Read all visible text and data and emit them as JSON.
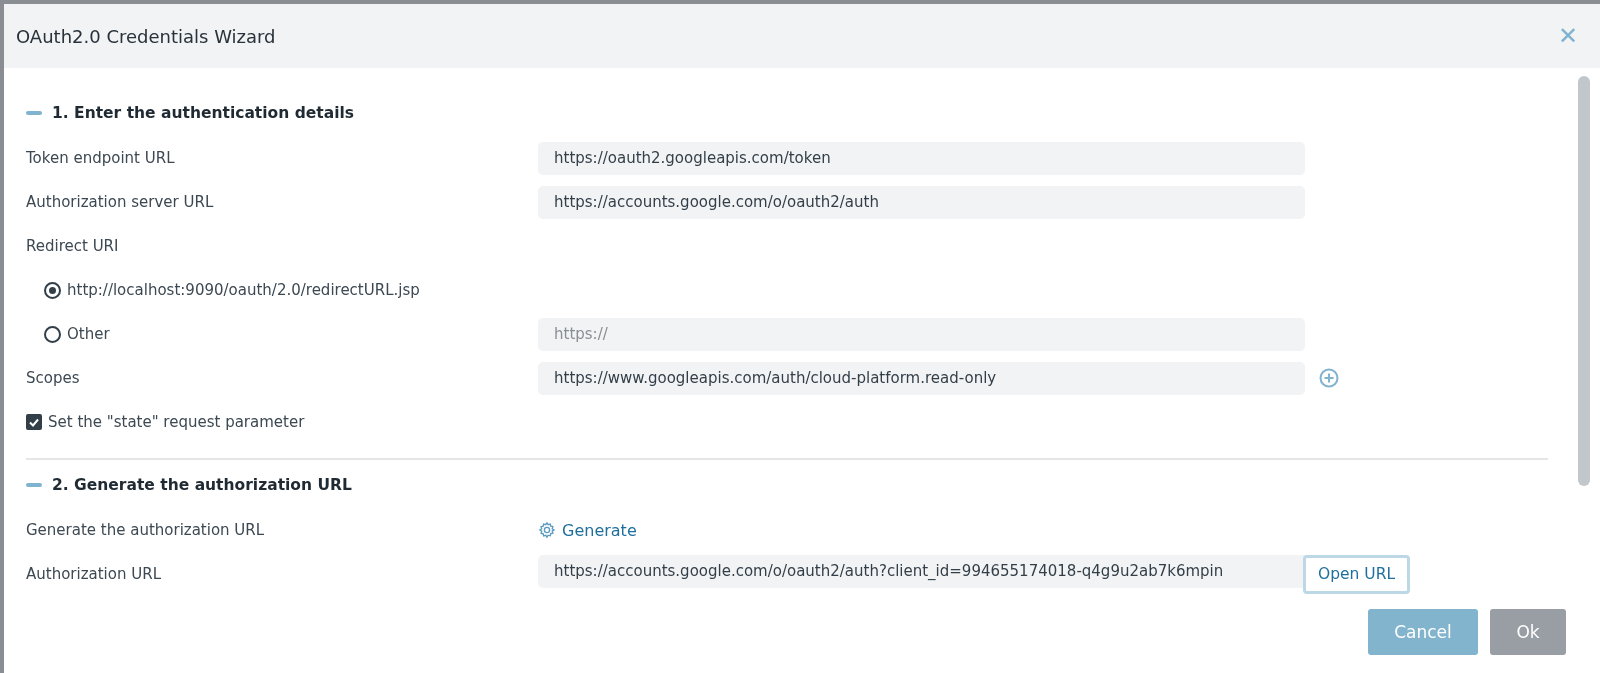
{
  "window": {
    "title": "OAuth2.0 Credentials Wizard",
    "close": "✕"
  },
  "sections": [
    {
      "title": "1. Enter the authentication details",
      "expanded": true,
      "rows": [
        {
          "kind": "field",
          "label": "Token endpoint URL",
          "value": "https://oauth2.googleapis.com/token"
        },
        {
          "kind": "field",
          "label": "Authorization server URL",
          "value": "https://accounts.google.com/o/oauth2/auth"
        },
        {
          "kind": "label",
          "label": "Redirect URI"
        },
        {
          "kind": "radio",
          "label": "http://localhost:9090/oauth/2.0/redirectURL.jsp",
          "selected": true
        },
        {
          "kind": "radio",
          "label": "Other",
          "selected": false,
          "placeholder": "https://"
        },
        {
          "kind": "field",
          "label": "Scopes",
          "value": "https://www.googleapis.com/auth/cloud-platform.read-only",
          "addable": true
        },
        {
          "kind": "checkbox",
          "label": "Set the \"state\" request parameter",
          "checked": true
        }
      ]
    },
    {
      "title": "2. Generate the authorization URL",
      "expanded": true,
      "rows": [
        {
          "kind": "action",
          "label": "Generate the authorization URL",
          "link": "Generate"
        },
        {
          "kind": "field",
          "label": "Authorization URL",
          "value": "https://accounts.google.com/o/oauth2/auth?client_id=994655174018-q4g9u2ab7k6mpin",
          "button": "Open URL"
        }
      ]
    }
  ],
  "buttons": [
    {
      "label": "Cancel",
      "kind": "secondary"
    },
    {
      "label": "Ok",
      "kind": "primary"
    }
  ]
}
